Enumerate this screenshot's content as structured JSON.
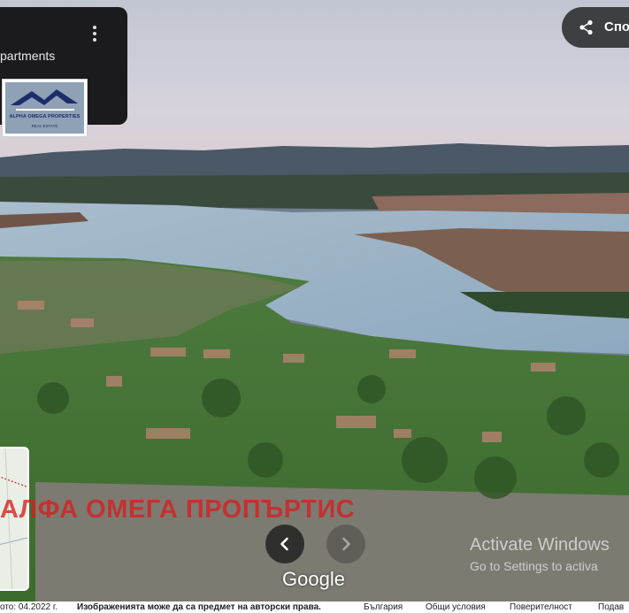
{
  "info_card": {
    "title": "partments",
    "more_icon": "more-vertical-icon"
  },
  "logo": {
    "line1": "ALPHA OMEGA PROPERTIES",
    "line2": "REAL ESTATE"
  },
  "share": {
    "label": "Спо",
    "icon": "share-icon"
  },
  "watermark": "АЛФА ОМЕГА ПРОПЪРТИС",
  "navigation": {
    "prev_icon": "chevron-left-icon",
    "next_icon": "chevron-right-icon"
  },
  "brand": "Google",
  "activate_windows": {
    "title": "Activate Windows",
    "subtitle": "Go to Settings to activa"
  },
  "footer": {
    "date": "ото: 04.2022 г.",
    "notice": "Изображенията може да са предмет на авторски права.",
    "country": "България",
    "terms": "Общи условия",
    "privacy": "Поверителност",
    "feedback": "Подав"
  },
  "colors": {
    "panel": "#1b1b1d",
    "share_button": "#3c4043",
    "watermark": "#d61e1e",
    "water": "#9bb2c6",
    "sky": "#c9cdd8"
  }
}
